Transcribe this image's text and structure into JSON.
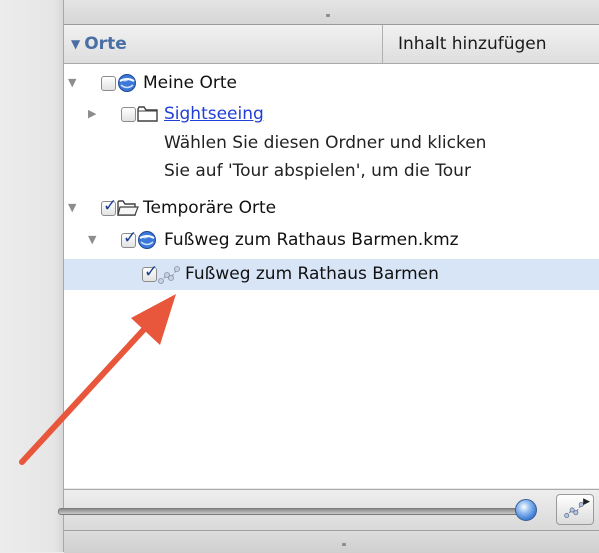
{
  "panel": {
    "title": "Orte",
    "title_icon": "disclosure-triangle-down",
    "add_content_label": "Inhalt hinzufügen"
  },
  "tree": {
    "items": [
      {
        "label": "Meine Orte",
        "expanded": true,
        "checked": false,
        "icon": "globe-icon",
        "link": false
      },
      {
        "label": "Sightseeing",
        "expanded": false,
        "checked": false,
        "icon": "folder-icon",
        "link": true,
        "description": [
          "Wählen Sie diesen Ordner und klicken",
          "Sie auf 'Tour abspielen', um die Tour"
        ]
      },
      {
        "label": "Temporäre Orte",
        "expanded": true,
        "checked": true,
        "icon": "open-folder-icon",
        "link": false
      },
      {
        "label": "Fußweg zum Rathaus Barmen.kmz",
        "expanded": true,
        "checked": true,
        "icon": "globe-icon",
        "link": false
      },
      {
        "label": "Fußweg zum Rathaus Barmen",
        "expanded": false,
        "checked": true,
        "icon": "path-icon",
        "link": false,
        "selected": true
      }
    ]
  },
  "toolbar": {
    "slider_value": 0.97,
    "view_button_icon": "path-icon"
  },
  "annotation": {
    "arrow_color": "#e8573b"
  },
  "colors": {
    "header_title": "#4a6fa5",
    "link": "#1f3fd6",
    "selection": "#d8e5f7",
    "checkmark": "#1b3f92"
  }
}
